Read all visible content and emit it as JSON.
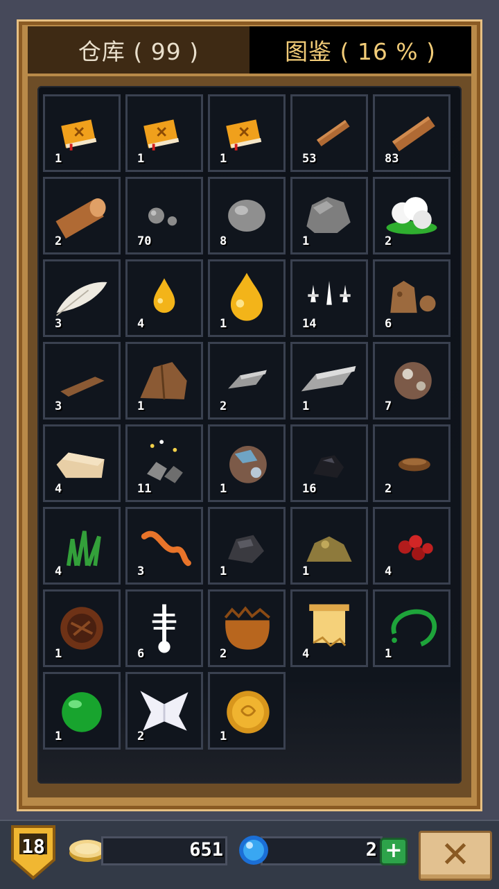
{
  "tabs": [
    {
      "label": "仓库 ( 99 )",
      "active": true
    },
    {
      "label": "图鉴 ( 16 % )",
      "active": false
    }
  ],
  "items": [
    {
      "icon": "book",
      "count": "1"
    },
    {
      "icon": "book",
      "count": "1"
    },
    {
      "icon": "book",
      "count": "1"
    },
    {
      "icon": "stick",
      "count": "53"
    },
    {
      "icon": "big-stick",
      "count": "83"
    },
    {
      "icon": "log",
      "count": "2"
    },
    {
      "icon": "pebbles",
      "count": "70"
    },
    {
      "icon": "stone",
      "count": "8"
    },
    {
      "icon": "rock",
      "count": "1"
    },
    {
      "icon": "cotton",
      "count": "2"
    },
    {
      "icon": "feather",
      "count": "3"
    },
    {
      "icon": "oil-drop",
      "count": "4"
    },
    {
      "icon": "big-oil-drop",
      "count": "1"
    },
    {
      "icon": "spikes",
      "count": "14"
    },
    {
      "icon": "dirt",
      "count": "6"
    },
    {
      "icon": "leather",
      "count": "3"
    },
    {
      "icon": "hide",
      "count": "1"
    },
    {
      "icon": "iron-ingot",
      "count": "2"
    },
    {
      "icon": "steel-ingot",
      "count": "1"
    },
    {
      "icon": "ore",
      "count": "7"
    },
    {
      "icon": "plank",
      "count": "4"
    },
    {
      "icon": "flint",
      "count": "11"
    },
    {
      "icon": "blue-ore",
      "count": "1"
    },
    {
      "icon": "coal",
      "count": "16"
    },
    {
      "icon": "nest",
      "count": "2"
    },
    {
      "icon": "grass",
      "count": "4"
    },
    {
      "icon": "worm",
      "count": "3"
    },
    {
      "icon": "charcoal",
      "count": "1"
    },
    {
      "icon": "sulfur",
      "count": "1"
    },
    {
      "icon": "berries",
      "count": "4"
    },
    {
      "icon": "shield",
      "count": "1"
    },
    {
      "icon": "skeleton",
      "count": "6"
    },
    {
      "icon": "pot",
      "count": "2"
    },
    {
      "icon": "scroll",
      "count": "4"
    },
    {
      "icon": "vine",
      "count": "1"
    },
    {
      "icon": "slime",
      "count": "1"
    },
    {
      "icon": "cloth",
      "count": "2"
    },
    {
      "icon": "gold-coin",
      "count": "1"
    }
  ],
  "level": "18",
  "gold": "651",
  "gems": "2",
  "plus_label": "+",
  "close_label": "✕"
}
